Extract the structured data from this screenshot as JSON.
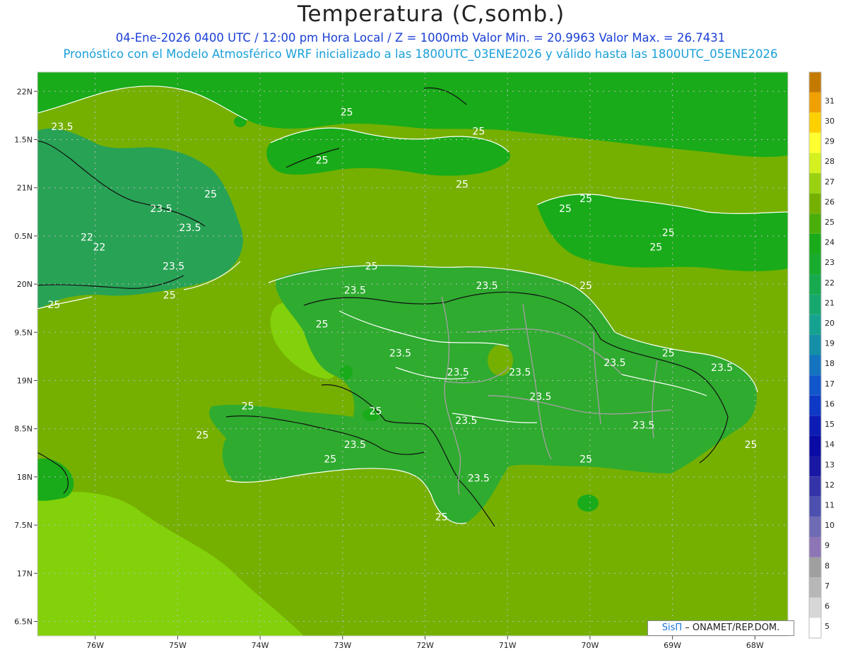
{
  "title": "Temperatura (C,somb.)",
  "subtitle_line1": "04-Ene-2026 0400 UTC / 12:00 pm Hora Local / Z = 1000mb   Valor Min. = 20.9963  Valor Max. = 26.7431",
  "subtitle_line2": "Pronóstico con el Modelo Atmosférico WRF inicializado a las 1800UTC_03ENE2026 y válido hasta las  1800UTC_05ENE2026",
  "credit": {
    "brand": "SisΠ",
    "text": " – ONAMET/REP.DOM."
  },
  "colors": {
    "sea": "#75b000",
    "land": "#19ab19",
    "land_warm": "#2fab2f",
    "land_cool": "#28a255",
    "warm_patch": "#83d10a",
    "coast": "#111111",
    "contour": "#ffffff",
    "province": "#a0a0a0",
    "grid": "#bbbbbb"
  },
  "chart_data": {
    "type": "heatmap",
    "lon_range": [
      -76.7,
      -67.6
    ],
    "lat_range": [
      16.35,
      22.2
    ],
    "lon_ticks": [
      -76,
      -75,
      -74,
      -73,
      -72,
      -71,
      -70,
      -69,
      -68
    ],
    "lon_tick_labels": [
      "76W",
      "75W",
      "74W",
      "73W",
      "72W",
      "71W",
      "70W",
      "69W",
      "68W"
    ],
    "lat_ticks": [
      22,
      21.5,
      21,
      20.5,
      20,
      19.5,
      19,
      18.5,
      18,
      17.5,
      17,
      16.5
    ],
    "lat_tick_labels": [
      "22N",
      "1.5N",
      "21N",
      "0.5N",
      "20N",
      "9.5N",
      "19N",
      "8.5N",
      "18N",
      "7.5N",
      "17N",
      "6.5N"
    ],
    "colorbar": [
      {
        "label": "5",
        "color": "#ffffff"
      },
      {
        "label": "6",
        "color": "#d7d7d7"
      },
      {
        "label": "7",
        "color": "#b7b7b7"
      },
      {
        "label": "8",
        "color": "#9f9f9f"
      },
      {
        "label": "9",
        "color": "#8e76b6"
      },
      {
        "label": "10",
        "color": "#6e6ab4"
      },
      {
        "label": "11",
        "color": "#4d50ae"
      },
      {
        "label": "12",
        "color": "#3434a8"
      },
      {
        "label": "13",
        "color": "#1818a4"
      },
      {
        "label": "14",
        "color": "#0a0aa4"
      },
      {
        "label": "15",
        "color": "#0c1cb4"
      },
      {
        "label": "16",
        "color": "#0e38c6"
      },
      {
        "label": "17",
        "color": "#1256cc"
      },
      {
        "label": "18",
        "color": "#1474c0"
      },
      {
        "label": "19",
        "color": "#158ea8"
      },
      {
        "label": "20",
        "color": "#16a290"
      },
      {
        "label": "21",
        "color": "#17a870"
      },
      {
        "label": "22",
        "color": "#17aa4e"
      },
      {
        "label": "23",
        "color": "#19ab2e"
      },
      {
        "label": "24",
        "color": "#19ab19"
      },
      {
        "label": "25",
        "color": "#4aae0a"
      },
      {
        "label": "26",
        "color": "#75b000"
      },
      {
        "label": "27",
        "color": "#9ad110"
      },
      {
        "label": "28",
        "color": "#d4f020"
      },
      {
        "label": "29",
        "color": "#ffff32"
      },
      {
        "label": "30",
        "color": "#ffd000"
      },
      {
        "label": "31",
        "color": "#f0a000"
      },
      {
        "label": "",
        "color": "#c47a00"
      }
    ],
    "contour_labels": [
      {
        "text": "23.5",
        "lon": -76.4,
        "lat": 21.6
      },
      {
        "text": "25",
        "lon": -72.95,
        "lat": 21.75
      },
      {
        "text": "25",
        "lon": -71.35,
        "lat": 21.55
      },
      {
        "text": "25",
        "lon": -73.25,
        "lat": 21.25
      },
      {
        "text": "25",
        "lon": -71.55,
        "lat": 21.0
      },
      {
        "text": "25",
        "lon": -74.6,
        "lat": 20.9
      },
      {
        "text": "23.5",
        "lon": -75.2,
        "lat": 20.75
      },
      {
        "text": "23.5",
        "lon": -74.85,
        "lat": 20.55
      },
      {
        "text": "22",
        "lon": -76.1,
        "lat": 20.45
      },
      {
        "text": "22",
        "lon": -75.95,
        "lat": 20.35
      },
      {
        "text": "25",
        "lon": -70.05,
        "lat": 20.85
      },
      {
        "text": "25",
        "lon": -70.3,
        "lat": 20.75
      },
      {
        "text": "25",
        "lon": -69.05,
        "lat": 20.5
      },
      {
        "text": "25",
        "lon": -69.2,
        "lat": 20.35
      },
      {
        "text": "23.5",
        "lon": -75.05,
        "lat": 20.15
      },
      {
        "text": "25",
        "lon": -72.65,
        "lat": 20.15
      },
      {
        "text": "25",
        "lon": -75.1,
        "lat": 19.85
      },
      {
        "text": "25",
        "lon": -76.5,
        "lat": 19.75
      },
      {
        "text": "23.5",
        "lon": -72.85,
        "lat": 19.9
      },
      {
        "text": "23.5",
        "lon": -71.25,
        "lat": 19.95
      },
      {
        "text": "25",
        "lon": -70.05,
        "lat": 19.95
      },
      {
        "text": "25",
        "lon": -73.25,
        "lat": 19.55
      },
      {
        "text": "23.5",
        "lon": -72.3,
        "lat": 19.25
      },
      {
        "text": "23.5",
        "lon": -71.6,
        "lat": 19.05
      },
      {
        "text": "23.5",
        "lon": -70.85,
        "lat": 19.05
      },
      {
        "text": "23.5",
        "lon": -69.7,
        "lat": 19.15
      },
      {
        "text": "25",
        "lon": -69.05,
        "lat": 19.25
      },
      {
        "text": "23.5",
        "lon": -68.4,
        "lat": 19.1
      },
      {
        "text": "23.5",
        "lon": -70.6,
        "lat": 18.8
      },
      {
        "text": "25",
        "lon": -74.15,
        "lat": 18.7
      },
      {
        "text": "25",
        "lon": -72.6,
        "lat": 18.65
      },
      {
        "text": "23.5",
        "lon": -71.5,
        "lat": 18.55
      },
      {
        "text": "23.5",
        "lon": -69.35,
        "lat": 18.5
      },
      {
        "text": "25",
        "lon": -74.7,
        "lat": 18.4
      },
      {
        "text": "23.5",
        "lon": -72.85,
        "lat": 18.3
      },
      {
        "text": "25",
        "lon": -73.15,
        "lat": 18.15
      },
      {
        "text": "25",
        "lon": -70.05,
        "lat": 18.15
      },
      {
        "text": "25",
        "lon": -68.05,
        "lat": 18.3
      },
      {
        "text": "23.5",
        "lon": -71.35,
        "lat": 17.95
      },
      {
        "text": "25",
        "lon": -71.8,
        "lat": 17.55
      }
    ]
  }
}
